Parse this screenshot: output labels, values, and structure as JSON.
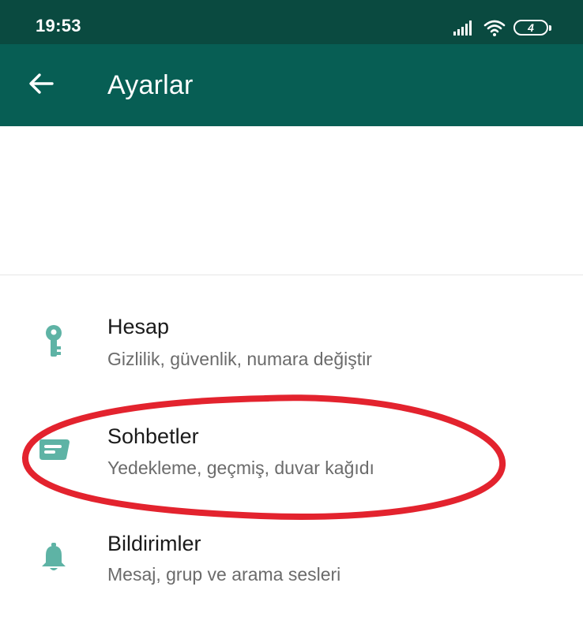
{
  "status_bar": {
    "time": "19:53",
    "battery": "4"
  },
  "app_bar": {
    "title": "Ayarlar",
    "back_icon": "arrow-left-icon"
  },
  "settings": {
    "items": [
      {
        "title": "Hesap",
        "subtitle": "Gizlilik, güvenlik, numara değiştir",
        "icon": "key-icon"
      },
      {
        "title": "Sohbetler",
        "subtitle": "Yedekleme, geçmiş, duvar kağıdı",
        "icon": "chat-icon"
      },
      {
        "title": "Bildirimler",
        "subtitle": "Mesaj, grup ve arama sesleri",
        "icon": "bell-icon"
      }
    ]
  },
  "colors": {
    "status_bar": "#0a4a40",
    "app_bar": "#075e54",
    "icon_accent": "#5eb3a5",
    "annotation": "#e3232e"
  }
}
